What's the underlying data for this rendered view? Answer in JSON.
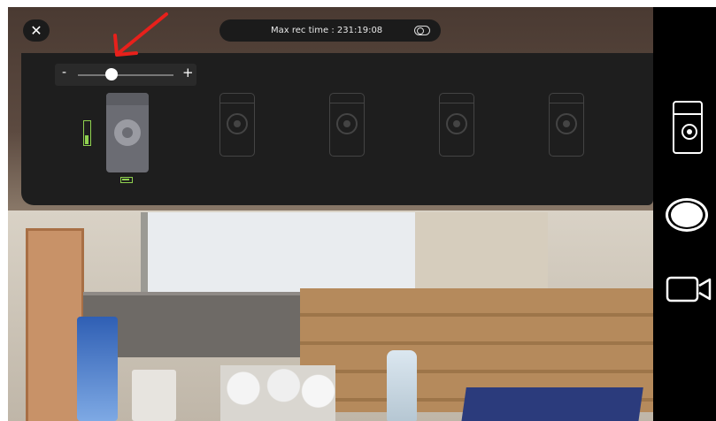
{
  "top_bar": {
    "close_glyph": "✕",
    "rec_time_label": "Max rec time : 231:19:08"
  },
  "zoom": {
    "minus": "-",
    "plus": "+",
    "level": 0.35
  },
  "devices": {
    "count": 5,
    "selected_index": 0,
    "battery": "full"
  },
  "colors": {
    "panel_bg": "#1e1e1e",
    "battery_green": "#8fd14f",
    "annotation_red": "#e8201b",
    "sidebar_bg": "#000000"
  },
  "icons": {
    "close": "close-icon",
    "rec_toggle": "toggle-icon",
    "device": "camera-device-icon",
    "shutter": "shutter-icon",
    "video": "video-camera-icon"
  }
}
